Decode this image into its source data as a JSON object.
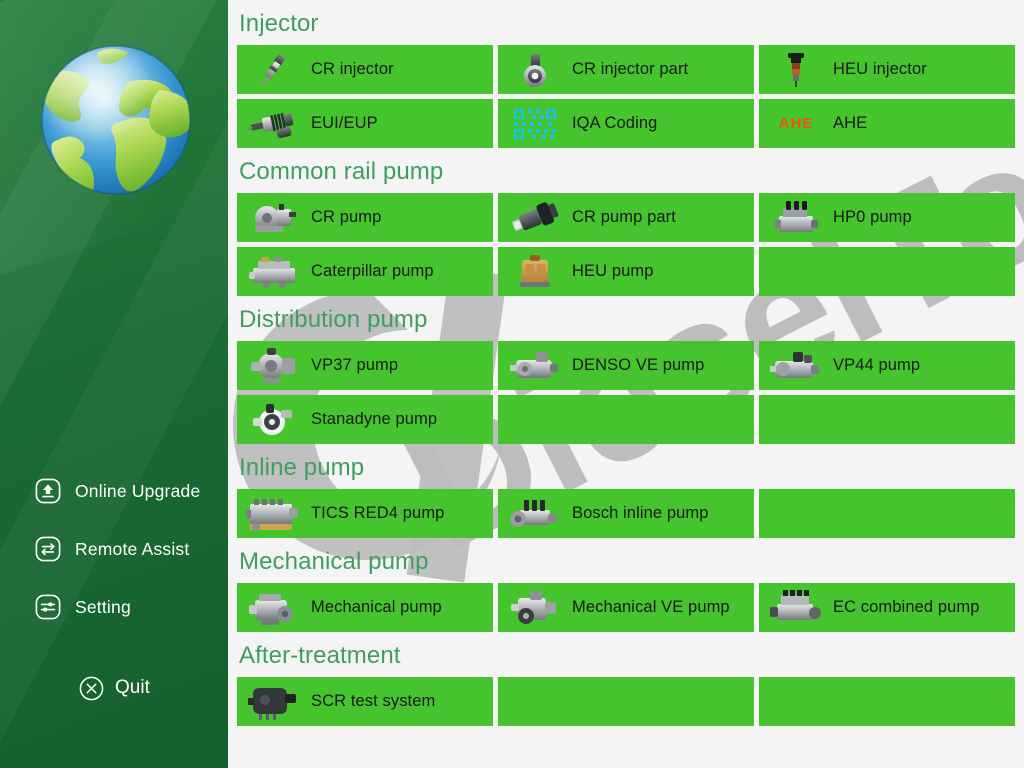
{
  "app": {
    "brand_watermark": "DieselTon",
    "accent_green": "#45c42e",
    "section_title_color": "#3f9e5f",
    "sidebar_green": "#1d7038",
    "background": "#f4f4f4"
  },
  "sidebar": {
    "logo": "globe-logo",
    "items": [
      {
        "label": "Online Upgrade",
        "icon": "upload-circle-icon"
      },
      {
        "label": "Remote Assist",
        "icon": "exchange-circle-icon"
      },
      {
        "label": "Setting",
        "icon": "sliders-circle-icon"
      }
    ],
    "quit": {
      "label": "Quit",
      "icon": "close-circle-icon"
    }
  },
  "main": {
    "sections": [
      {
        "title": "Injector",
        "tiles": [
          {
            "label": "CR injector",
            "icon": "cr-injector-icon"
          },
          {
            "label": "CR injector part",
            "icon": "cr-injector-part-icon"
          },
          {
            "label": "HEU injector",
            "icon": "heu-injector-icon"
          },
          {
            "label": "EUI/EUP",
            "icon": "eui-eup-icon"
          },
          {
            "label": "IQA Coding",
            "icon": "qr-code-icon"
          },
          {
            "label": "AHE",
            "icon": "ahe-text-icon",
            "icon_text": "AHE",
            "icon_color": "#f0540a"
          }
        ]
      },
      {
        "title": "Common rail pump",
        "tiles": [
          {
            "label": "CR pump",
            "icon": "cr-pump-icon"
          },
          {
            "label": "CR pump part",
            "icon": "cr-pump-part-icon"
          },
          {
            "label": "HP0 pump",
            "icon": "hp0-pump-icon"
          },
          {
            "label": "Caterpillar pump",
            "icon": "caterpillar-pump-icon"
          },
          {
            "label": "HEU pump",
            "icon": "heu-pump-icon"
          },
          {
            "label": "",
            "icon": ""
          }
        ]
      },
      {
        "title": "Distribution pump",
        "tiles": [
          {
            "label": "VP37 pump",
            "icon": "vp37-pump-icon"
          },
          {
            "label": "DENSO VE pump",
            "icon": "denso-ve-pump-icon"
          },
          {
            "label": "VP44 pump",
            "icon": "vp44-pump-icon"
          },
          {
            "label": "Stanadyne pump",
            "icon": "stanadyne-pump-icon"
          },
          {
            "label": "",
            "icon": ""
          },
          {
            "label": "",
            "icon": ""
          }
        ]
      },
      {
        "title": "Inline pump",
        "tiles": [
          {
            "label": "TICS RED4 pump",
            "icon": "tics-red4-pump-icon"
          },
          {
            "label": "Bosch inline pump",
            "icon": "bosch-inline-pump-icon"
          },
          {
            "label": "",
            "icon": ""
          }
        ]
      },
      {
        "title": "Mechanical pump",
        "tiles": [
          {
            "label": "Mechanical pump",
            "icon": "mechanical-pump-icon"
          },
          {
            "label": "Mechanical VE pump",
            "icon": "mechanical-ve-pump-icon"
          },
          {
            "label": "EC combined pump",
            "icon": "ec-combined-pump-icon"
          }
        ]
      },
      {
        "title": "After-treatment",
        "tiles": [
          {
            "label": "SCR test system",
            "icon": "scr-test-system-icon"
          },
          {
            "label": "",
            "icon": ""
          },
          {
            "label": "",
            "icon": ""
          }
        ]
      }
    ]
  }
}
